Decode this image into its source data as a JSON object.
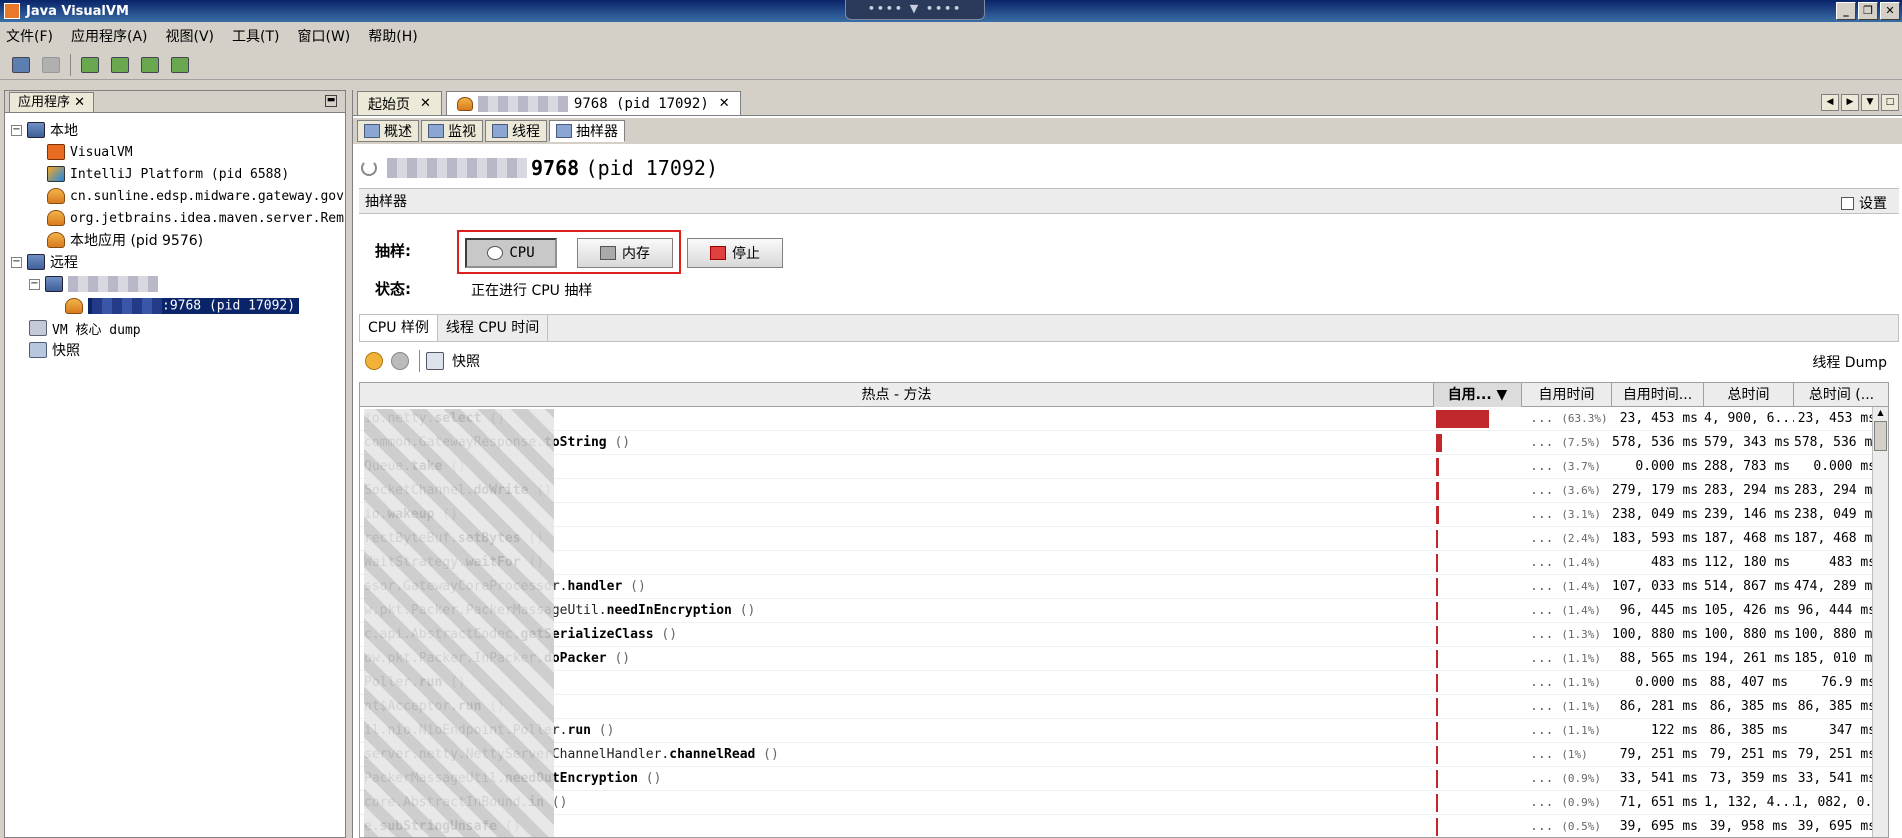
{
  "window": {
    "title": "Java VisualVM"
  },
  "menu": [
    "文件(F)",
    "应用程序(A)",
    "视图(V)",
    "工具(T)",
    "窗口(W)",
    "帮助(H)"
  ],
  "left_panel": {
    "tab_label": "应用程序",
    "tree": [
      {
        "label": "本地",
        "level": 0,
        "icon": "computer-icon",
        "expanded": true
      },
      {
        "label": "VisualVM",
        "level": 1,
        "icon": "visualvm-icon"
      },
      {
        "label": "IntelliJ Platform (pid 6588)",
        "level": 1,
        "icon": "intellij-icon"
      },
      {
        "label": "cn.sunline.edsp.midware.gateway.gov",
        "level": 1,
        "icon": "java-icon"
      },
      {
        "label": "org.jetbrains.idea.maven.server.Rem",
        "level": 1,
        "icon": "java-icon"
      },
      {
        "label": "本地应用 (pid 9576)",
        "level": 1,
        "icon": "java-icon"
      },
      {
        "label": "远程",
        "level": 0,
        "icon": "computer-icon",
        "expanded": true
      },
      {
        "label": "",
        "level": 1,
        "icon": "computer-icon",
        "expanded": true
      },
      {
        "label": ":9768 (pid 17092)",
        "level": 2,
        "icon": "jmx-icon",
        "selected": true
      },
      {
        "label": "VM 核心 dump",
        "level": 0,
        "icon": "dump-icon"
      },
      {
        "label": "快照",
        "level": 0,
        "icon": "snapshot-icon"
      }
    ]
  },
  "doc_tabs": [
    {
      "label": "起始页",
      "active": false
    },
    {
      "label": "9768 (pid 17092)",
      "active": true
    }
  ],
  "sub_tabs": [
    {
      "label": "概述",
      "icon": "overview-icon"
    },
    {
      "label": "监视",
      "icon": "monitor-icon"
    },
    {
      "label": "线程",
      "icon": "threads-icon"
    },
    {
      "label": "抽样器",
      "icon": "sampler-icon",
      "active": true
    }
  ],
  "process": {
    "port": "9768",
    "pid": "(pid 17092)"
  },
  "sampler": {
    "header": "抽样器",
    "settings_label": "设置",
    "sample_label": "抽样:",
    "cpu_button": "CPU",
    "memory_button": "内存",
    "stop_button": "停止",
    "status_label": "状态:",
    "status_value": "正在进行 CPU 抽样"
  },
  "views": [
    "CPU 样例",
    "线程 CPU 时间"
  ],
  "controls": {
    "snapshot_label": "快照",
    "thread_dump": "线程 Dump"
  },
  "table": {
    "columns": [
      "热点 - 方法",
      "自用...",
      "自用时间",
      "自用时间...",
      "总时间",
      "总时间 (..."
    ],
    "rows": [
      {
        "pkg": "io.netty.",
        "method": "select",
        "pct": "(63.3%)",
        "frac": 0.633,
        "self": "23, 453 ms",
        "total": "4, 900, 6...",
        "cpu": "23, 453 ms"
      },
      {
        "pkg": "common.GatewayResponse.",
        "method": "toString",
        "pct": "(7.5%)",
        "frac": 0.075,
        "self": "578, 536 ms",
        "total": "579, 343 ms",
        "cpu": "578, 536 ms"
      },
      {
        "pkg": "Queue.",
        "method": "take",
        "pct": "(3.7%)",
        "frac": 0.037,
        "self": "0.000 ms",
        "total": "288, 783 ms",
        "cpu": "0.000 ms"
      },
      {
        "pkg": "SocketChannel.",
        "method": "doWrite",
        "pct": "(3.6%)",
        "frac": 0.036,
        "self": "279, 179 ms",
        "total": "283, 294 ms",
        "cpu": "283, 294 ms"
      },
      {
        "pkg": "io.",
        "method": "wakeup",
        "pct": "(3.1%)",
        "frac": 0.031,
        "self": "238, 049 ms",
        "total": "239, 146 ms",
        "cpu": "238, 049 ms"
      },
      {
        "pkg": "rectByteBuf.",
        "method": "setBytes",
        "pct": "(2.4%)",
        "frac": 0.024,
        "self": "183, 593 ms",
        "total": "187, 468 ms",
        "cpu": "187, 468 ms"
      },
      {
        "pkg": "WaitStrategy.",
        "method": "waitFor",
        "pct": "(1.4%)",
        "frac": 0.014,
        "self": "483 ms",
        "total": "112, 180 ms",
        "cpu": "483 ms"
      },
      {
        "pkg": "ssor.GatewayCoreProcessor.",
        "method": "handler",
        "pct": "(1.4%)",
        "frac": 0.014,
        "self": "107, 033 ms",
        "total": "514, 867 ms",
        "cpu": "474, 289 ms"
      },
      {
        "pkg": "w.pkt.Packer.PackerMassageUtil.",
        "method": "needInEncryption",
        "pct": "(1.4%)",
        "frac": 0.014,
        "self": "96, 445 ms",
        "total": "105, 426 ms",
        "cpu": "96, 444 ms"
      },
      {
        "pkg": "c.api.AbstractCodec.",
        "method": "getSerializeClass",
        "pct": "(1.3%)",
        "frac": 0.013,
        "self": "100, 880 ms",
        "total": "100, 880 ms",
        "cpu": "100, 880 ms"
      },
      {
        "pkg": "ow.pkt.Packer.InPacker.",
        "method": "doPacker",
        "pct": "(1.1%)",
        "frac": 0.011,
        "self": "88, 565 ms",
        "total": "194, 261 ms",
        "cpu": "185, 010 ms"
      },
      {
        "pkg": "Poller.",
        "method": "run",
        "pct": "(1.1%)",
        "frac": 0.011,
        "self": "0.000 ms",
        "total": "88, 407 ms",
        "cpu": "76.9 ms"
      },
      {
        "pkg": "nt$Acceptor.",
        "method": "run",
        "pct": "(1.1%)",
        "frac": 0.011,
        "self": "86, 281 ms",
        "total": "86, 385 ms",
        "cpu": "86, 385 ms"
      },
      {
        "pkg": "il.nio.NioEndpoint.Poller.",
        "method": "run",
        "pct": "(1.1%)",
        "frac": 0.011,
        "self": "122 ms",
        "total": "86, 385 ms",
        "cpu": "347 ms"
      },
      {
        "pkg": "server.netty.NettyServerChannelHandler.",
        "method": "channelRead",
        "pct": "(1%)",
        "frac": 0.01,
        "self": "79, 251 ms",
        "total": "79, 251 ms",
        "cpu": "79, 251 ms"
      },
      {
        "pkg": "PackerMassageUtil.",
        "method": "needOutEncryption",
        "pct": "(0.9%)",
        "frac": 0.009,
        "self": "33, 541 ms",
        "total": "73, 359 ms",
        "cpu": "33, 541 ms"
      },
      {
        "pkg": "core.AbstractInBound.",
        "method": "in",
        "pct": "(0.9%)",
        "frac": 0.009,
        "self": "71, 651 ms",
        "total": "1, 132, 4...",
        "cpu": "1, 082, 0..."
      },
      {
        "pkg": "e.",
        "method": "subStringUnsafe",
        "pct": "(0.5%)",
        "frac": 0.005,
        "self": "39, 695 ms",
        "total": "39, 958 ms",
        "cpu": "39, 695 ms"
      }
    ]
  }
}
